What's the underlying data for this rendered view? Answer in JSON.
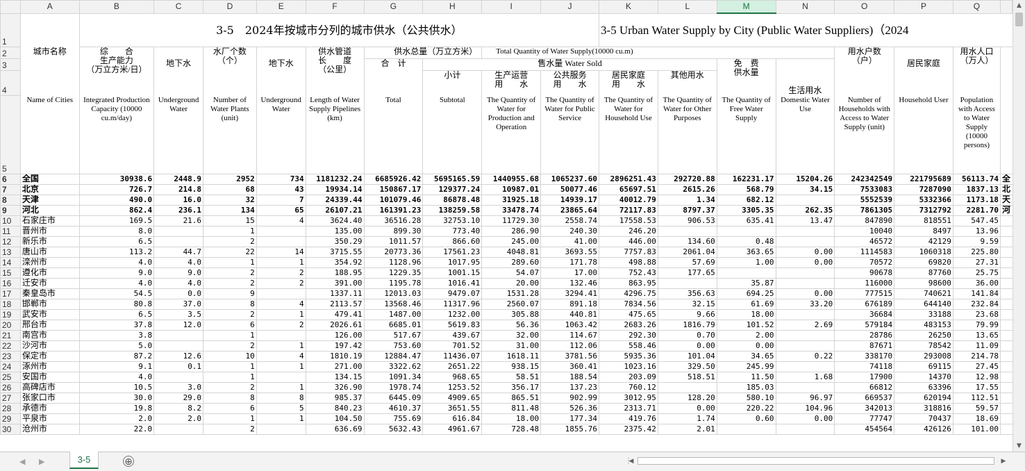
{
  "columns": [
    "A",
    "B",
    "C",
    "D",
    "E",
    "F",
    "G",
    "H",
    "I",
    "J",
    "K",
    "L",
    "M",
    "N",
    "O",
    "P",
    "Q"
  ],
  "selected_column": "M",
  "row_numbers": [
    "1",
    "2",
    "3",
    "4",
    "5",
    "6",
    "7",
    "8",
    "9",
    "10",
    "11",
    "12",
    "13",
    "14",
    "15",
    "16",
    "17",
    "18",
    "19",
    "20",
    "21",
    "22",
    "23",
    "24",
    "25",
    "26",
    "27",
    "28",
    "29",
    "30"
  ],
  "title": {
    "cn": "3-5　2024年按城市分列的城市供水（公共供水）",
    "en": "3-5 Urban Water Supply by City (Public Water Suppliers)（2024"
  },
  "headers": {
    "city_name": "城市名称",
    "capacity": "综　　合\n生产能力\n（万立方米/日）",
    "groundwater": "地下水",
    "plants": "水厂个数\n（个）",
    "plants_groundwater": "地下水",
    "pipeline": "供水管道\n长　　度\n（公里）",
    "total_supply_cn": "供水总量（万立方米）",
    "total_supply_en": "Total Quantity of Water Supply(10000 cu.m)",
    "total": "合　计",
    "sold": "售水量 Water Sold",
    "subtotal": "小计",
    "production": "生产运营\n用　　水",
    "public": "公共服务\n用　　水",
    "household": "居民家庭\n用　　水",
    "other": "其他用水",
    "free": "免　费\n供水量",
    "domestic": "生活用水",
    "households_count": "用水户数\n（户）",
    "household_user": "居民家庭",
    "population": "用水人口\n（万人）"
  },
  "headers_en": {
    "city_name": "Name of Cities",
    "capacity": "Integrated Production Capacity (10000 cu.m/day)",
    "groundwater": "Underground Water",
    "plants": "Number of Water Plants (unit)",
    "plants_groundwater": "Underground Water",
    "pipeline": "Length of Water Supply Pipelines (km)",
    "total": "Total",
    "subtotal": "Subtotal",
    "production": "The Quantity of Water for Production and Operation",
    "public": "The Quantity of Water for Public Service",
    "household": "The Quantity of Water for Household Use",
    "other": "The Quantity of Water for Other Purposes",
    "free": "The Quantity of Free Water Supply",
    "domestic": "Domestic Water Use",
    "households_count": "Number of Households with Access to Water Supply (unit)",
    "household_user": "Household User",
    "population": "Population with Access to Water Supply (10000 persons)"
  },
  "rows": [
    {
      "name": "全国",
      "bold": true,
      "city": false,
      "cells": [
        "30938.6",
        "2448.9",
        "2952",
        "734",
        "1181232.24",
        "6685926.42",
        "5695165.59",
        "1440955.68",
        "1065237.60",
        "2896251.43",
        "292720.88",
        "162231.17",
        "15204.26",
        "242342549",
        "221795689",
        "56113.74"
      ],
      "overflow": "全"
    },
    {
      "name": "北京",
      "bold": true,
      "city": false,
      "cells": [
        "726.7",
        "214.8",
        "68",
        "43",
        "19934.14",
        "150867.17",
        "129377.24",
        "10987.01",
        "50077.46",
        "65697.51",
        "2615.26",
        "568.79",
        "34.15",
        "7533083",
        "7287090",
        "1837.13"
      ],
      "overflow": "北"
    },
    {
      "name": "天津",
      "bold": true,
      "city": false,
      "cells": [
        "490.0",
        "16.0",
        "32",
        "7",
        "24339.44",
        "101079.46",
        "86878.48",
        "31925.18",
        "14939.17",
        "40012.79",
        "1.34",
        "682.12",
        "",
        "5552539",
        "5332366",
        "1173.18"
      ],
      "overflow": "天"
    },
    {
      "name": "河北",
      "bold": true,
      "city": false,
      "cells": [
        "862.4",
        "236.1",
        "134",
        "65",
        "26107.21",
        "161391.23",
        "138259.58",
        "33478.74",
        "23865.64",
        "72117.83",
        "8797.37",
        "3305.35",
        "262.35",
        "7861305",
        "7312792",
        "2281.70"
      ],
      "overflow": "河"
    },
    {
      "name": "石家庄市",
      "bold": false,
      "city": true,
      "cells": [
        "169.5",
        "21.6",
        "15",
        "4",
        "3624.40",
        "36516.28",
        "32753.10",
        "11729.30",
        "2558.74",
        "17558.53",
        "906.53",
        "635.41",
        "13.47",
        "847890",
        "818551",
        "547.45"
      ]
    },
    {
      "name": "晋州市",
      "bold": false,
      "city": true,
      "cells": [
        "8.0",
        "",
        "1",
        "",
        "135.00",
        "899.30",
        "773.40",
        "286.90",
        "240.30",
        "246.20",
        "",
        "",
        "",
        "10040",
        "8497",
        "13.96"
      ]
    },
    {
      "name": "新乐市",
      "bold": false,
      "city": true,
      "cells": [
        "6.5",
        "",
        "2",
        "",
        "350.29",
        "1011.57",
        "866.60",
        "245.00",
        "41.00",
        "446.00",
        "134.60",
        "0.48",
        "",
        "46572",
        "42129",
        "9.59"
      ]
    },
    {
      "name": "唐山市",
      "bold": false,
      "city": true,
      "cells": [
        "113.2",
        "44.7",
        "22",
        "14",
        "3715.55",
        "20773.36",
        "17561.23",
        "4048.81",
        "3693.55",
        "7757.83",
        "2061.04",
        "363.65",
        "0.00",
        "1114583",
        "1060318",
        "225.80"
      ]
    },
    {
      "name": "滦州市",
      "bold": false,
      "city": true,
      "cells": [
        "4.0",
        "4.0",
        "1",
        "1",
        "354.92",
        "1128.96",
        "1017.95",
        "289.60",
        "171.78",
        "498.88",
        "57.69",
        "1.00",
        "0.00",
        "70572",
        "69820",
        "27.31"
      ]
    },
    {
      "name": "遵化市",
      "bold": false,
      "city": true,
      "cells": [
        "9.0",
        "9.0",
        "2",
        "2",
        "188.95",
        "1229.35",
        "1001.15",
        "54.07",
        "17.00",
        "752.43",
        "177.65",
        "",
        "",
        "90678",
        "87760",
        "25.75"
      ]
    },
    {
      "name": "迁安市",
      "bold": false,
      "city": true,
      "cells": [
        "4.0",
        "4.0",
        "2",
        "2",
        "391.00",
        "1195.78",
        "1016.41",
        "20.00",
        "132.46",
        "863.95",
        "",
        "35.87",
        "",
        "116000",
        "98600",
        "36.00"
      ]
    },
    {
      "name": "秦皇岛市",
      "bold": false,
      "city": true,
      "cells": [
        "54.5",
        "0.0",
        "9",
        "",
        "1337.11",
        "12013.03",
        "9479.07",
        "1531.28",
        "3294.41",
        "4296.75",
        "356.63",
        "694.25",
        "0.00",
        "777515",
        "740621",
        "141.84"
      ]
    },
    {
      "name": "邯郸市",
      "bold": false,
      "city": true,
      "cells": [
        "80.8",
        "37.0",
        "8",
        "4",
        "2113.57",
        "13568.46",
        "11317.96",
        "2560.07",
        "891.18",
        "7834.56",
        "32.15",
        "61.69",
        "33.20",
        "676189",
        "644140",
        "232.84"
      ]
    },
    {
      "name": "武安市",
      "bold": false,
      "city": true,
      "cells": [
        "6.5",
        "3.5",
        "2",
        "1",
        "479.41",
        "1487.00",
        "1232.00",
        "305.88",
        "440.81",
        "475.65",
        "9.66",
        "18.00",
        "",
        "36684",
        "33188",
        "23.68"
      ]
    },
    {
      "name": "邢台市",
      "bold": false,
      "city": true,
      "cells": [
        "37.8",
        "12.0",
        "6",
        "2",
        "2026.61",
        "6685.01",
        "5619.83",
        "56.36",
        "1063.42",
        "2683.26",
        "1816.79",
        "101.52",
        "2.69",
        "579184",
        "483153",
        "79.99"
      ]
    },
    {
      "name": "南宫市",
      "bold": false,
      "city": true,
      "cells": [
        "3.8",
        "",
        "1",
        "",
        "126.00",
        "517.67",
        "439.67",
        "32.00",
        "114.67",
        "292.30",
        "0.70",
        "2.00",
        "",
        "28786",
        "26250",
        "13.65"
      ]
    },
    {
      "name": "沙河市",
      "bold": false,
      "city": true,
      "cells": [
        "5.0",
        "",
        "2",
        "1",
        "197.42",
        "753.60",
        "701.52",
        "31.00",
        "112.06",
        "558.46",
        "0.00",
        "0.00",
        "",
        "87671",
        "78542",
        "11.09"
      ]
    },
    {
      "name": "保定市",
      "bold": false,
      "city": true,
      "cells": [
        "87.2",
        "12.6",
        "10",
        "4",
        "1810.19",
        "12884.47",
        "11436.07",
        "1618.11",
        "3781.56",
        "5935.36",
        "101.04",
        "34.65",
        "0.22",
        "338170",
        "293008",
        "214.78"
      ]
    },
    {
      "name": "涿州市",
      "bold": false,
      "city": true,
      "cells": [
        "9.1",
        "0.1",
        "1",
        "1",
        "271.00",
        "3322.62",
        "2651.22",
        "938.15",
        "360.41",
        "1023.16",
        "329.50",
        "245.99",
        "",
        "74118",
        "69115",
        "27.45"
      ]
    },
    {
      "name": "安国市",
      "bold": false,
      "city": true,
      "cells": [
        "4.0",
        "",
        "1",
        "",
        "134.15",
        "1091.34",
        "968.65",
        "58.51",
        "188.54",
        "203.09",
        "518.51",
        "11.50",
        "1.68",
        "17900",
        "14370",
        "12.98"
      ]
    },
    {
      "name": "高碑店市",
      "bold": false,
      "city": true,
      "cells": [
        "10.5",
        "3.0",
        "2",
        "1",
        "326.90",
        "1978.74",
        "1253.52",
        "356.17",
        "137.23",
        "760.12",
        "",
        "185.03",
        "",
        "66812",
        "63396",
        "17.55"
      ]
    },
    {
      "name": "张家口市",
      "bold": false,
      "city": true,
      "cells": [
        "30.0",
        "29.0",
        "8",
        "8",
        "985.37",
        "6445.09",
        "4909.65",
        "865.51",
        "902.99",
        "3012.95",
        "128.20",
        "580.10",
        "96.97",
        "669537",
        "620194",
        "112.51"
      ]
    },
    {
      "name": "承德市",
      "bold": false,
      "city": true,
      "cells": [
        "19.8",
        "8.2",
        "6",
        "5",
        "840.23",
        "4610.37",
        "3651.55",
        "811.48",
        "526.36",
        "2313.71",
        "0.00",
        "220.22",
        "104.96",
        "342013",
        "318816",
        "59.57"
      ]
    },
    {
      "name": "平泉市",
      "bold": false,
      "city": true,
      "cells": [
        "2.0",
        "2.0",
        "1",
        "1",
        "104.50",
        "755.69",
        "616.84",
        "18.00",
        "177.34",
        "419.76",
        "1.74",
        "0.60",
        "0.00",
        "77747",
        "70437",
        "18.69"
      ]
    },
    {
      "name": "沧州市",
      "bold": false,
      "city": true,
      "cells": [
        "22.0",
        "",
        "2",
        "",
        "636.69",
        "5632.43",
        "4961.67",
        "728.48",
        "1855.76",
        "2375.42",
        "2.01",
        "",
        "",
        "454564",
        "426126",
        "101.00"
      ]
    }
  ],
  "sheet_tab": "3-5",
  "bottom": {
    "add_sheet": "⊕"
  },
  "colors": {
    "accent": "#217346",
    "header_bg": "#f2f2f2",
    "grid": "#d4d4d4"
  }
}
